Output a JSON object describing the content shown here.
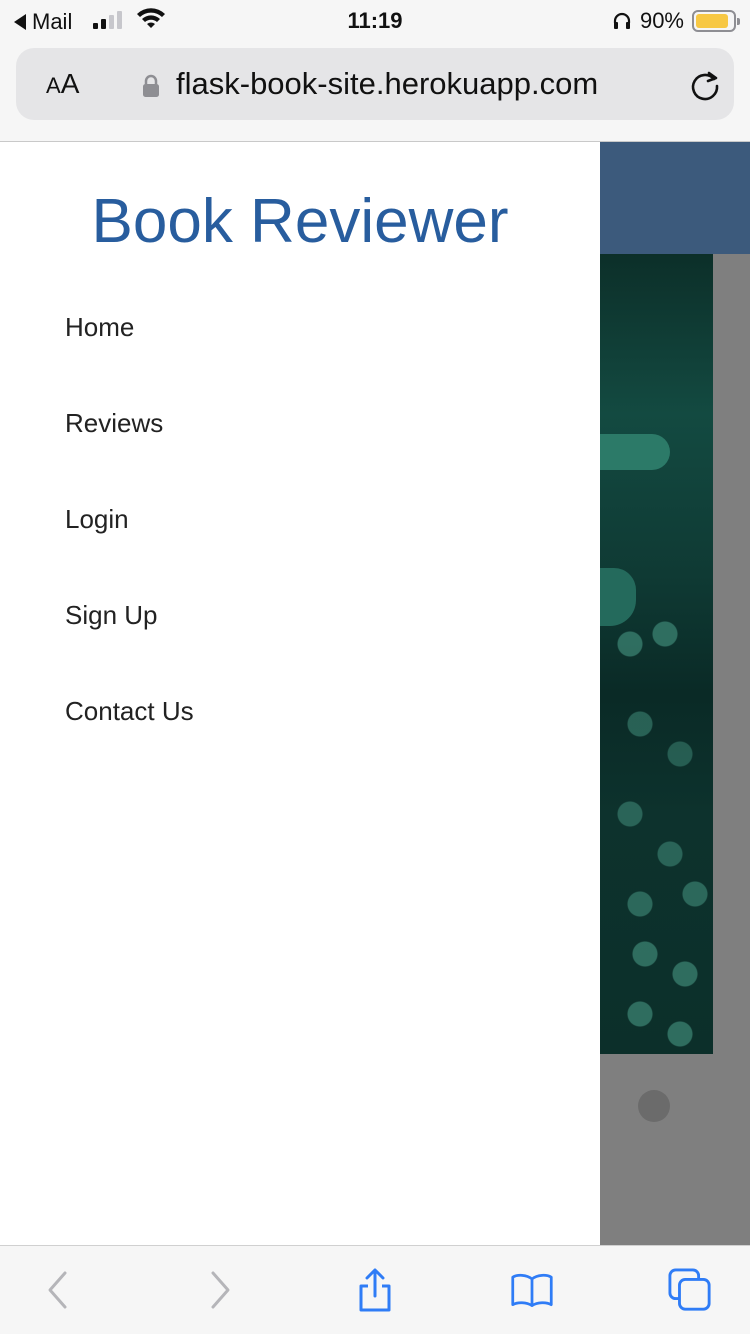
{
  "status_bar": {
    "back_app": "Mail",
    "time": "11:19",
    "battery_percent": "90%",
    "battery_level": 0.9,
    "battery_color": "#f7c844"
  },
  "address_bar": {
    "text_size_label_small": "A",
    "text_size_label_large": "A",
    "url": "flask-book-site.herokuapp.com"
  },
  "side_nav": {
    "brand": "Book Reviewer",
    "brand_color": "#285d9e",
    "items": [
      {
        "label": "Home"
      },
      {
        "label": "Reviews"
      },
      {
        "label": "Login"
      },
      {
        "label": "Sign Up"
      },
      {
        "label": "Contact Us"
      }
    ]
  },
  "page": {
    "header_color": "#3c5a7c"
  },
  "toolbar": {
    "icons": [
      "back-icon",
      "forward-icon",
      "share-icon",
      "bookmarks-icon",
      "tabs-icon"
    ],
    "accent_color": "#2f7cf6"
  }
}
